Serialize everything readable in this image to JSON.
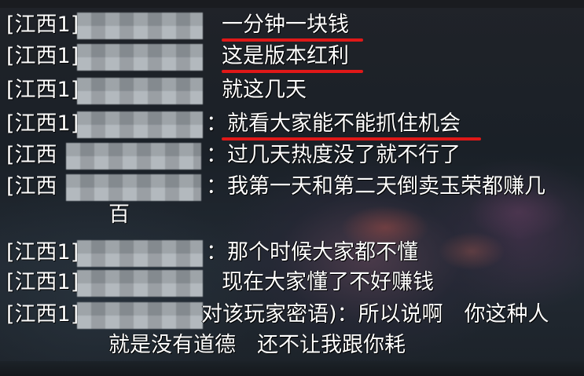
{
  "chat": {
    "lines": [
      {
        "prefix": "[江西1]",
        "message": "一分钟一块钱",
        "underlined": true
      },
      {
        "prefix": "[江西1]",
        "message": "这是版本红利",
        "underlined": true
      },
      {
        "prefix": "[江西1]",
        "message": "就这几天",
        "underlined": false
      },
      {
        "prefix": "[江西1]",
        "message": "：就看大家能不能抓住机会",
        "underlined": true
      },
      {
        "prefix": "[江西",
        "message": "：过几天热度没了就不行了",
        "underlined": false
      },
      {
        "prefix": "[江西",
        "message": "：我第一天和第二天倒卖玉荣都赚几",
        "underlined": false
      },
      {
        "prefix": "",
        "message": "百",
        "underlined": false
      },
      {
        "prefix": "[江西1]",
        "message": "：那个时候大家都不懂",
        "underlined": false
      },
      {
        "prefix": "[江西1]",
        "message": "现在大家懂了不好赚钱",
        "underlined": false
      },
      {
        "prefix": "[江西1]",
        "message": "对该玩家密语)：所以说啊　你这种人",
        "underlined": false
      },
      {
        "prefix": "",
        "message": "就是没有道德　还不让我跟你耗",
        "underlined": false
      }
    ],
    "highlight_color": "#e01818"
  }
}
